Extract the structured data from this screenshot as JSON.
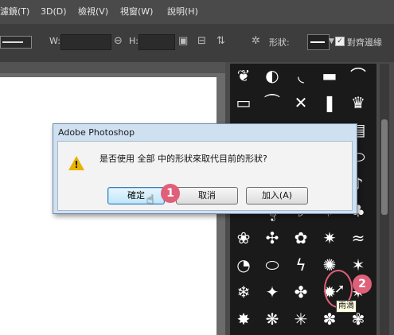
{
  "menubar": {
    "items": [
      {
        "label": "濾鏡(T)"
      },
      {
        "label": "3D(D)"
      },
      {
        "label": "檢視(V)"
      },
      {
        "label": "視窗(W)"
      },
      {
        "label": "說明(H)"
      }
    ]
  },
  "options_bar": {
    "w_label": "W:",
    "h_label": "H:",
    "shape_label": "形狀:",
    "align_label": "對齊邊緣",
    "align_checked": true
  },
  "dialog": {
    "title": "Adobe Photoshop",
    "message": "是否使用 全部 中的形狀來取代目前的形狀?",
    "ok_label": "確定",
    "cancel_label": "取消",
    "append_label": "加入(A)"
  },
  "steps": [
    "1",
    "2"
  ],
  "tooltip": "雨滴",
  "icons": {
    "warning": "warning-icon",
    "link": "link-icon",
    "gear": "gear-icon",
    "cursor": "arrow-cursor-icon"
  },
  "colors": {
    "menubar_bg": "#4a4a4a",
    "options_bg": "#3d3d3d",
    "dialog_title_bg": "#cfe0f1",
    "badge": "#e0607a",
    "warning": "#e8b400",
    "tooltip_bg": "#ffffe1"
  },
  "shapes": [
    "❦",
    "◐",
    "◟",
    "▬",
    "⌒",
    "▭",
    "⏜",
    "✕",
    "❚",
    "♛",
    "▭",
    "▬",
    "▯",
    "▭",
    "▤",
    "♥",
    "❤",
    "♡",
    "✱",
    "⬭",
    "♩",
    "♩",
    "♪",
    "♫",
    "♪",
    "𝄢",
    "𝄞",
    "♭",
    "♯",
    "♣",
    "❀",
    "✣",
    "✿",
    "✷",
    "≈",
    "◔",
    "⬭",
    "ϟ",
    "✺",
    "✶",
    "❄",
    "✦",
    "✤",
    "✹",
    "✷",
    "✸",
    "❋",
    "✳",
    "✽",
    "✾"
  ]
}
